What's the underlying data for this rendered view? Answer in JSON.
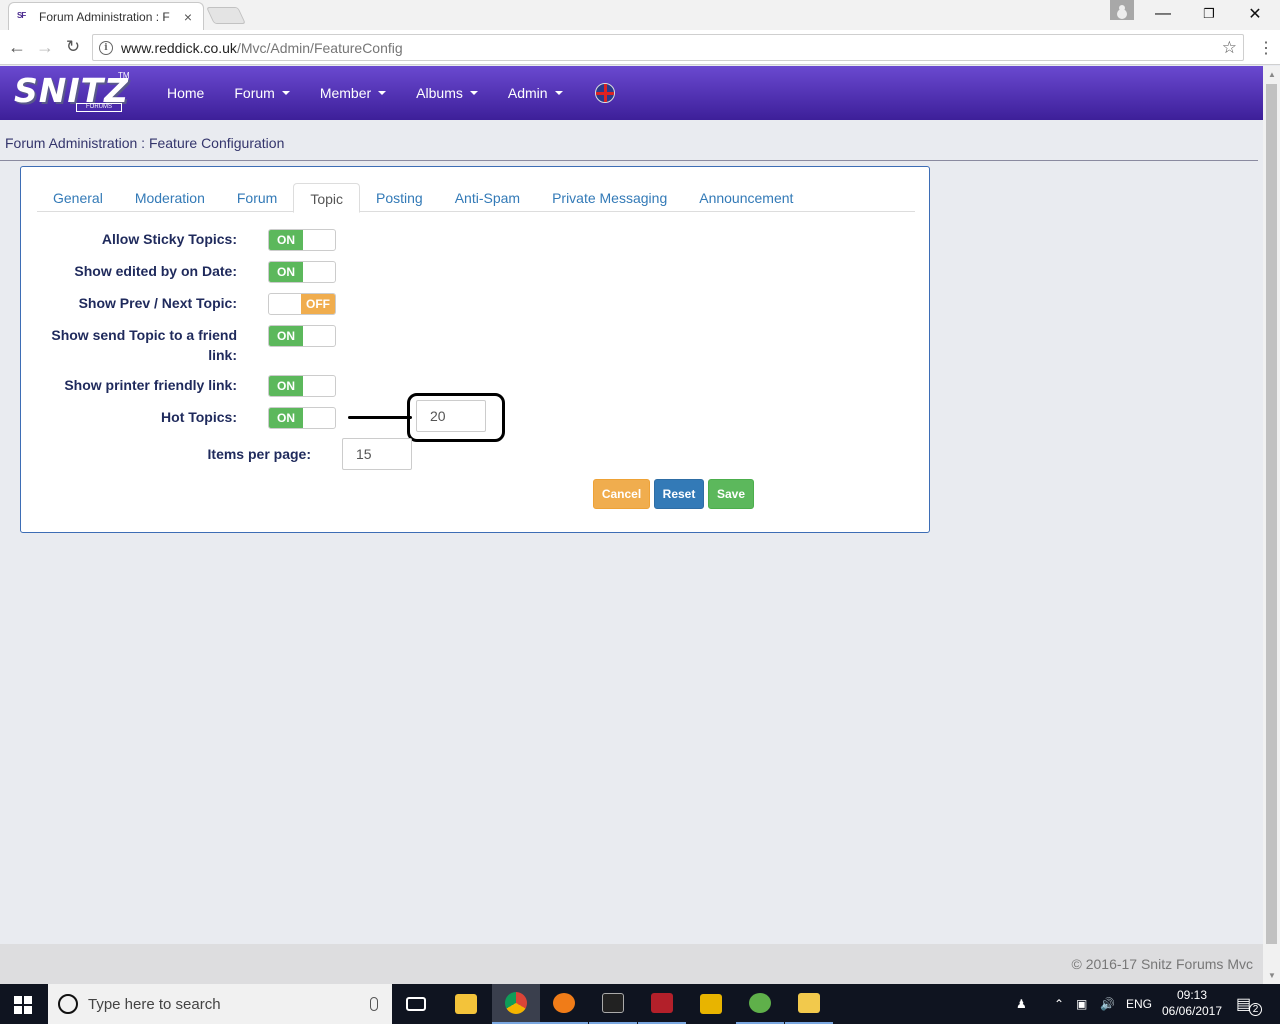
{
  "browser": {
    "tab_title": "Forum Administration : F",
    "tab_favicon": "SF",
    "url_host": "www.reddick.co.uk",
    "url_path": "/Mvc/Admin/FeatureConfig"
  },
  "navbar": {
    "logo_text": "SNITZ",
    "logo_sub": "FORUMS",
    "logo_tm": "TM",
    "links": [
      {
        "label": "Home",
        "dropdown": false
      },
      {
        "label": "Forum",
        "dropdown": true
      },
      {
        "label": "Member",
        "dropdown": true
      },
      {
        "label": "Albums",
        "dropdown": true
      },
      {
        "label": "Admin",
        "dropdown": true
      }
    ]
  },
  "breadcrumb": "Forum Administration : Feature Configuration",
  "tabs": [
    {
      "label": "General",
      "active": false
    },
    {
      "label": "Moderation",
      "active": false
    },
    {
      "label": "Forum",
      "active": false
    },
    {
      "label": "Topic",
      "active": true
    },
    {
      "label": "Posting",
      "active": false
    },
    {
      "label": "Anti-Spam",
      "active": false
    },
    {
      "label": "Private Messaging",
      "active": false
    },
    {
      "label": "Announcement",
      "active": false
    }
  ],
  "settings": {
    "sticky": {
      "label": "Allow Sticky Topics:",
      "state": "ON"
    },
    "edited": {
      "label": "Show edited by on Date:",
      "state": "ON"
    },
    "prevnext": {
      "label": "Show Prev / Next Topic:",
      "state": "OFF"
    },
    "sendfriend": {
      "label_line1": "Show send Topic to a friend",
      "label_line2": "link:",
      "state": "ON"
    },
    "printer": {
      "label": "Show printer friendly link:",
      "state": "ON"
    },
    "hot": {
      "label": "Hot Topics:",
      "state": "ON",
      "value": "20"
    },
    "perpage": {
      "label": "Items per page:",
      "value": "15"
    }
  },
  "buttons": {
    "cancel": "Cancel",
    "reset": "Reset",
    "save": "Save"
  },
  "footer": "© 2016-17 Snitz Forums Mvc",
  "taskbar": {
    "search_placeholder": "Type here to search",
    "language": "ENG",
    "time": "09:13",
    "date": "06/06/2017",
    "notification_count": "2"
  },
  "colors": {
    "nav_top": "#6a49d0",
    "nav_bottom": "#3d1f99",
    "switch_on": "#5cb85c",
    "switch_off": "#f0ad4e",
    "link": "#337ab7"
  }
}
